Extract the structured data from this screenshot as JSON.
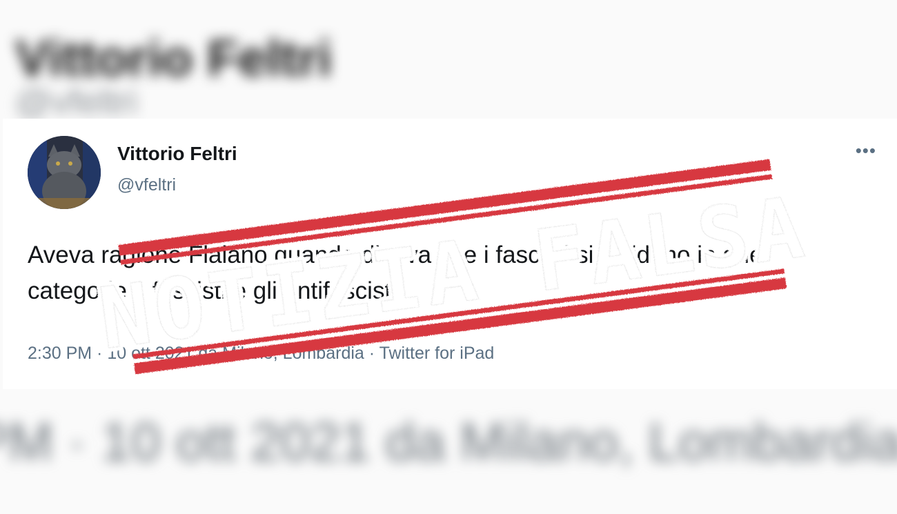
{
  "background": {
    "name": "Vittorio Feltri",
    "handle": "@vfeltri",
    "meta": "PM · 10 ott 2021 da Milano, Lombardia · Twitter for iPad"
  },
  "tweet": {
    "author_name": "Vittorio Feltri",
    "author_handle": "@vfeltri",
    "text": "Aveva ragione Flaiano quando diceva che i fascisti si dividono in due categorie: i fascisti e gli antifascisti.",
    "time": "2:30 PM",
    "date_location": "10 ott 2021 da Milano, Lombardia",
    "source": "Twitter for iPad",
    "separator": " · ",
    "more_icon": "more-horizontal-icon"
  },
  "stamp": {
    "text": "NOTIZIA FALSA",
    "color": "#d7373f"
  }
}
